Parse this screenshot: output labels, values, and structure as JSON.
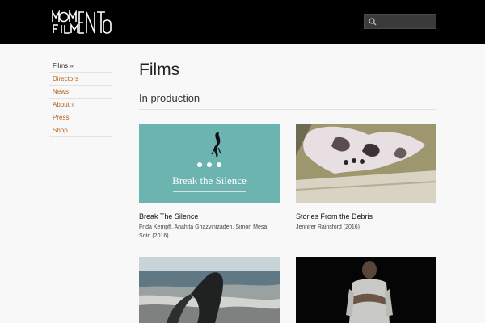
{
  "header": {
    "logo_alt": "MOMENTO FILM",
    "search": {
      "placeholder": "",
      "value": ""
    }
  },
  "sidebar": {
    "items": [
      {
        "label": "Films »",
        "active": true
      },
      {
        "label": "Directors",
        "active": false
      },
      {
        "label": "News",
        "active": false
      },
      {
        "label": "About »",
        "active": false
      },
      {
        "label": "Press",
        "active": false
      },
      {
        "label": "Shop",
        "active": false
      }
    ]
  },
  "main": {
    "title": "Films",
    "section": "In production",
    "films": [
      {
        "title": "Break The Silence",
        "credits": "Frida Kempff, Anahita Ghazvinizadeh, Simón Mesa Soto (2016)",
        "poster_title": "Break the Silence"
      },
      {
        "title": "Stories From the Debris",
        "credits": "Jennifer Rainsford (2016)"
      },
      {
        "title": "",
        "credits": ""
      },
      {
        "title": "",
        "credits": ""
      }
    ]
  },
  "colors": {
    "link": "#b5651d",
    "header_bg": "#000000",
    "poster_teal": "#6bb4b0"
  }
}
